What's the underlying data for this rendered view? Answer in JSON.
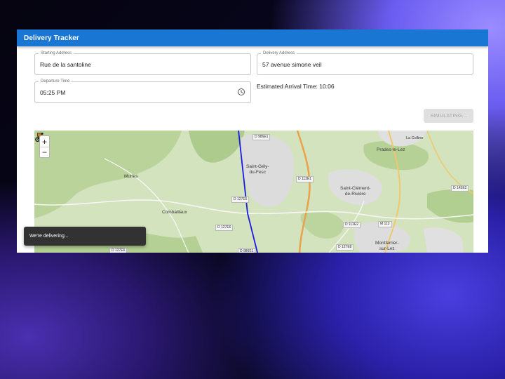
{
  "app": {
    "title": "Delivery Tracker"
  },
  "form": {
    "starting_address": {
      "label": "Starting Address",
      "value": "Rue de la santoline"
    },
    "delivery_address": {
      "label": "Delivery Address",
      "value": "57 avenue simone veil"
    },
    "departure_time": {
      "label": "Departure Time",
      "value": "05:25 PM",
      "icon": "clock-icon"
    },
    "eta": "Estimated Arrival Time: 10:06",
    "simulate_button": {
      "label": "SIMULATING...",
      "disabled": true
    }
  },
  "map": {
    "zoom_in": "+",
    "zoom_out": "−",
    "towns": [
      "Saint-Gély-du-Fesc",
      "Murles",
      "Combaillaux",
      "Saint-Clément-de-Rivière",
      "Prades-le-Lez",
      "Montferrier-sur-Lez",
      "La Colline"
    ],
    "roads": [
      "D 986E1",
      "D 112E1",
      "D 127E5",
      "D 127E6",
      "D 127E8",
      "D 112E2",
      "M 112",
      "D 127E8",
      "D 145E2",
      "D 127E6",
      "D 986E1"
    ],
    "route_color": "#1a1ae6",
    "courier_icon": "motorbike-icon"
  },
  "snackbar": {
    "message": "We're delivering..."
  },
  "colors": {
    "primary": "#1976d2",
    "snackbar": "#323232"
  }
}
